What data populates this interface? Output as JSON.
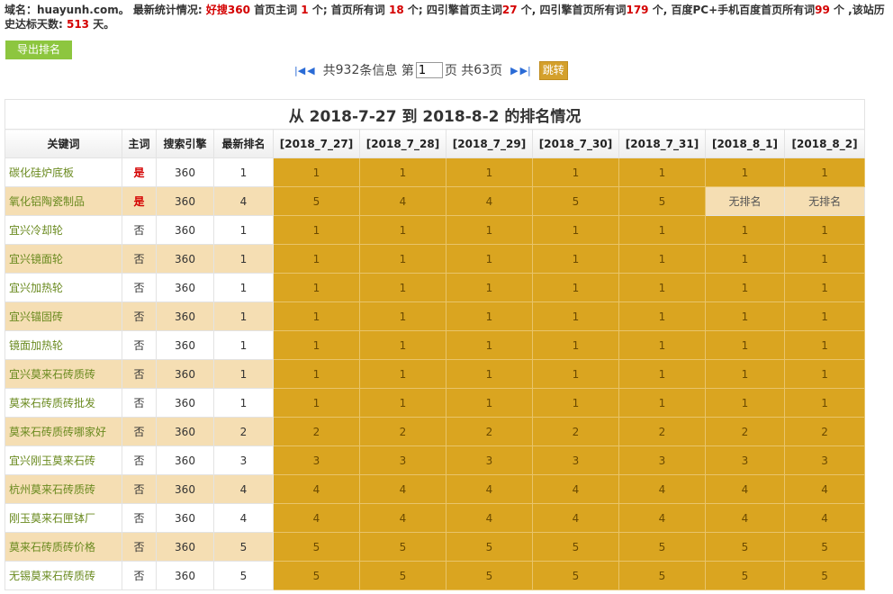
{
  "summary": {
    "domain_label": "域名：",
    "domain": "huayunh.com",
    "sep": "。",
    "latest_label": " 最新统计情况: ",
    "haosou_label": "好搜360",
    "home_main_label": " 首页主词 ",
    "home_main": "1",
    "home_all_label": " 个; 首页所有词 ",
    "home_all": "18",
    "four_main_label": " 个; 四引擎首页主词",
    "four_main": "27",
    "four_all_label": " 个, 四引擎首页所有词",
    "four_all": "179",
    "baidu_label": " 个, 百度PC+手机百度首页所有词",
    "baidu_all": "99",
    "history_label": " 个 ,该站历史达标天数: ",
    "history_days": "513",
    "history_unit": " 天。"
  },
  "toolbar": {
    "export_label": "导出排名"
  },
  "pager": {
    "total_prefix": "共 ",
    "total": "932",
    "total_suffix": " 条信息 第",
    "page_value": "1",
    "page_suffix": "页 共 ",
    "pages": "63",
    "pages_suffix": " 页",
    "go_label": "跳转",
    "first_glyph": "|◀",
    "prev_glyph": "◀",
    "next_glyph": "▶",
    "last_glyph": "▶|"
  },
  "table": {
    "title": "从 2018-7-27 到 2018-8-2 的排名情况",
    "headers": [
      "关键词",
      "主词",
      "搜索引擎",
      "最新排名",
      "[2018_7_27]",
      "[2018_7_28]",
      "[2018_7_29]",
      "[2018_7_30]",
      "[2018_7_31]",
      "[2018_8_1]",
      "[2018_8_2]"
    ],
    "rows": [
      {
        "kw": "碳化硅炉底板",
        "main": "是",
        "engine": "360",
        "latest": "1",
        "days": [
          "1",
          "1",
          "1",
          "1",
          "1",
          "1",
          "1"
        ]
      },
      {
        "kw": "氧化铝陶瓷制品",
        "main": "是",
        "engine": "360",
        "latest": "4",
        "days": [
          "5",
          "4",
          "4",
          "5",
          "5",
          "无排名",
          "无排名"
        ]
      },
      {
        "kw": "宜兴冷却轮",
        "main": "否",
        "engine": "360",
        "latest": "1",
        "days": [
          "1",
          "1",
          "1",
          "1",
          "1",
          "1",
          "1"
        ]
      },
      {
        "kw": "宜兴镜面轮",
        "main": "否",
        "engine": "360",
        "latest": "1",
        "days": [
          "1",
          "1",
          "1",
          "1",
          "1",
          "1",
          "1"
        ]
      },
      {
        "kw": "宜兴加热轮",
        "main": "否",
        "engine": "360",
        "latest": "1",
        "days": [
          "1",
          "1",
          "1",
          "1",
          "1",
          "1",
          "1"
        ]
      },
      {
        "kw": "宜兴锚固砖",
        "main": "否",
        "engine": "360",
        "latest": "1",
        "days": [
          "1",
          "1",
          "1",
          "1",
          "1",
          "1",
          "1"
        ]
      },
      {
        "kw": "镜面加热轮",
        "main": "否",
        "engine": "360",
        "latest": "1",
        "days": [
          "1",
          "1",
          "1",
          "1",
          "1",
          "1",
          "1"
        ]
      },
      {
        "kw": "宜兴莫来石砖质砖",
        "main": "否",
        "engine": "360",
        "latest": "1",
        "days": [
          "1",
          "1",
          "1",
          "1",
          "1",
          "1",
          "1"
        ]
      },
      {
        "kw": "莫来石砖质砖批发",
        "main": "否",
        "engine": "360",
        "latest": "1",
        "days": [
          "1",
          "1",
          "1",
          "1",
          "1",
          "1",
          "1"
        ]
      },
      {
        "kw": "莫来石砖质砖哪家好",
        "main": "否",
        "engine": "360",
        "latest": "2",
        "days": [
          "2",
          "2",
          "2",
          "2",
          "2",
          "2",
          "2"
        ]
      },
      {
        "kw": "宜兴刚玉莫来石砖",
        "main": "否",
        "engine": "360",
        "latest": "3",
        "days": [
          "3",
          "3",
          "3",
          "3",
          "3",
          "3",
          "3"
        ]
      },
      {
        "kw": "杭州莫来石砖质砖",
        "main": "否",
        "engine": "360",
        "latest": "4",
        "days": [
          "4",
          "4",
          "4",
          "4",
          "4",
          "4",
          "4"
        ]
      },
      {
        "kw": "刚玉莫来石匣钵厂",
        "main": "否",
        "engine": "360",
        "latest": "4",
        "days": [
          "4",
          "4",
          "4",
          "4",
          "4",
          "4",
          "4"
        ]
      },
      {
        "kw": "莫来石砖质砖价格",
        "main": "否",
        "engine": "360",
        "latest": "5",
        "days": [
          "5",
          "5",
          "5",
          "5",
          "5",
          "5",
          "5"
        ]
      },
      {
        "kw": "无锡莫来石砖质砖",
        "main": "否",
        "engine": "360",
        "latest": "5",
        "days": [
          "5",
          "5",
          "5",
          "5",
          "5",
          "5",
          "5"
        ]
      }
    ]
  }
}
